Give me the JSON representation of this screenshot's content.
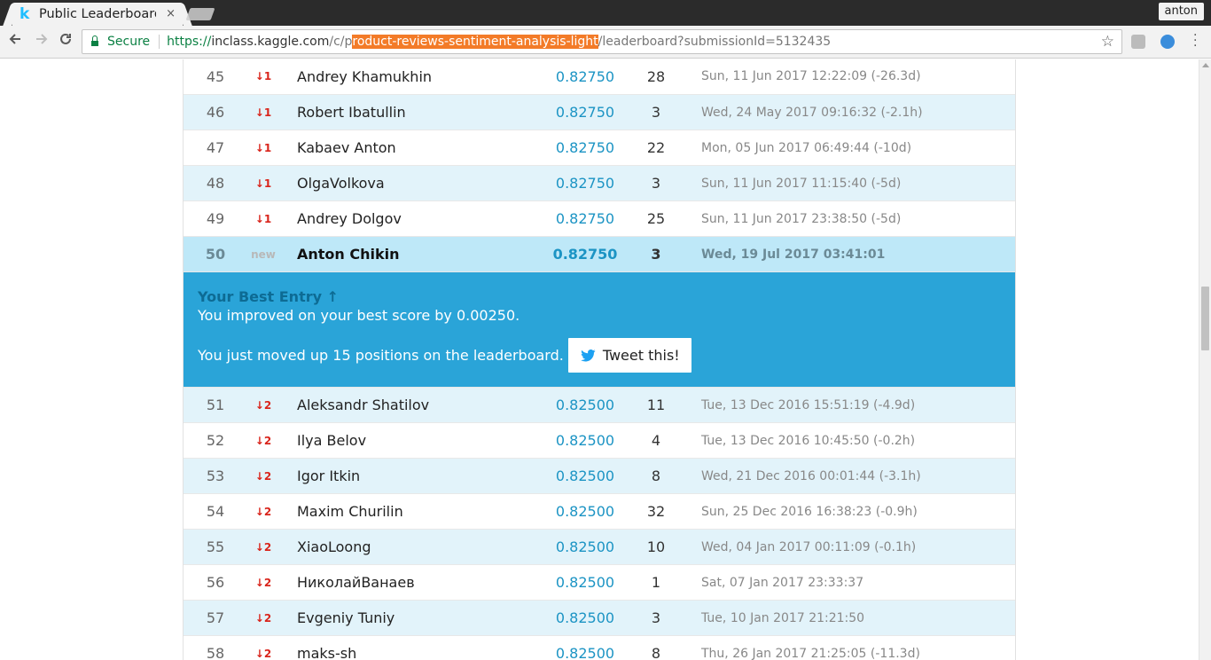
{
  "browser": {
    "tab_title": "Public Leaderboard",
    "tab_close": "×",
    "profile_name": "anton",
    "secure_label": "Secure",
    "url_scheme": "https://",
    "url_host": "inclass.kaggle.com",
    "url_path_before": "/c/p",
    "url_path_selected": "roduct-reviews-sentiment-analysis-light",
    "url_path_after": "/leaderboard?submissionId=5132435"
  },
  "leaderboard": {
    "rows_before": [
      {
        "rank": "45",
        "change": "↓1",
        "name": "Andrey Khamukhin",
        "score": "0.82750",
        "entries": "28",
        "last": "Sun, 11 Jun 2017 12:22:09 (-26.3d)"
      },
      {
        "rank": "46",
        "change": "↓1",
        "name": "Robert Ibatullin",
        "score": "0.82750",
        "entries": "3",
        "last": "Wed, 24 May 2017 09:16:32 (-2.1h)"
      },
      {
        "rank": "47",
        "change": "↓1",
        "name": "Kabaev Anton",
        "score": "0.82750",
        "entries": "22",
        "last": "Mon, 05 Jun 2017 06:49:44 (-10d)"
      },
      {
        "rank": "48",
        "change": "↓1",
        "name": "OlgaVolkova",
        "score": "0.82750",
        "entries": "3",
        "last": "Sun, 11 Jun 2017 11:15:40 (-5d)"
      },
      {
        "rank": "49",
        "change": "↓1",
        "name": "Andrey Dolgov",
        "score": "0.82750",
        "entries": "25",
        "last": "Sun, 11 Jun 2017 23:38:50 (-5d)"
      }
    ],
    "my_row": {
      "rank": "50",
      "change": "new",
      "name": "Anton Chikin",
      "score": "0.82750",
      "entries": "3",
      "last": "Wed, 19 Jul 2017 03:41:01"
    },
    "banner": {
      "title": "Your Best Entry ↑",
      "improved": "You improved on your best score by 0.00250.",
      "moved": "You just moved up 15 positions on the leaderboard.",
      "tweet_label": "Tweet this!"
    },
    "rows_after": [
      {
        "rank": "51",
        "change": "↓2",
        "name": "Aleksandr Shatilov",
        "score": "0.82500",
        "entries": "11",
        "last": "Tue, 13 Dec 2016 15:51:19 (-4.9d)"
      },
      {
        "rank": "52",
        "change": "↓2",
        "name": "Ilya Belov",
        "score": "0.82500",
        "entries": "4",
        "last": "Tue, 13 Dec 2016 10:45:50 (-0.2h)"
      },
      {
        "rank": "53",
        "change": "↓2",
        "name": "Igor Itkin",
        "score": "0.82500",
        "entries": "8",
        "last": "Wed, 21 Dec 2016 00:01:44 (-3.1h)"
      },
      {
        "rank": "54",
        "change": "↓2",
        "name": "Maxim Churilin",
        "score": "0.82500",
        "entries": "32",
        "last": "Sun, 25 Dec 2016 16:38:23 (-0.9h)"
      },
      {
        "rank": "55",
        "change": "↓2",
        "name": "XiaoLoong",
        "score": "0.82500",
        "entries": "10",
        "last": "Wed, 04 Jan 2017 00:11:09 (-0.1h)"
      },
      {
        "rank": "56",
        "change": "↓2",
        "name": "НиколайВанаев",
        "score": "0.82500",
        "entries": "1",
        "last": "Sat, 07 Jan 2017 23:33:37"
      },
      {
        "rank": "57",
        "change": "↓2",
        "name": "Evgeniy Tuniy",
        "score": "0.82500",
        "entries": "3",
        "last": "Tue, 10 Jan 2017 21:21:50"
      },
      {
        "rank": "58",
        "change": "↓2",
        "name": "maks-sh",
        "score": "0.82500",
        "entries": "8",
        "last": "Thu, 26 Jan 2017 21:25:05 (-11.3d)"
      }
    ]
  },
  "colors": {
    "banner_bg": "#2aa4d8",
    "my_row_bg": "#bee8f8",
    "alt_row_bg": "#e2f3fa",
    "score_blue": "#1c94c4",
    "change_red": "#d9251c"
  }
}
